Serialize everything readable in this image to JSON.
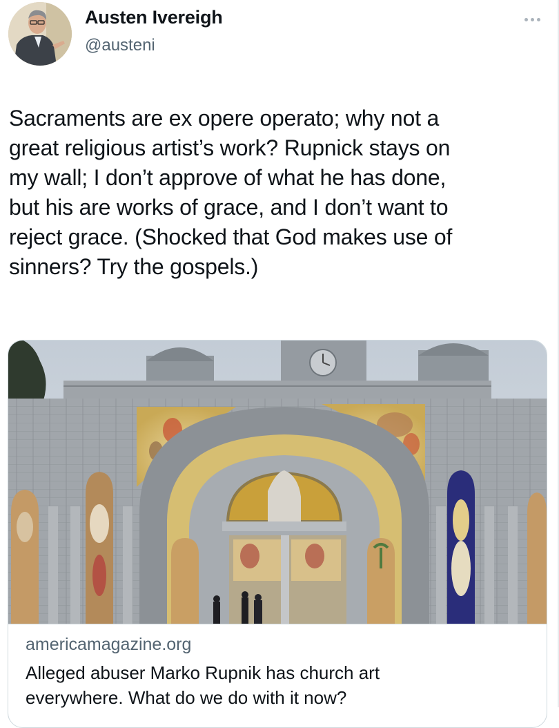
{
  "author": {
    "display_name": "Austen Ivereigh",
    "handle": "@austeni"
  },
  "icons": {
    "more": "more-options-icon"
  },
  "tweet": {
    "lines": [
      "Sacraments are ex opere operato; why not a",
      "great religious artist’s work? Rupnick stays on",
      "my wall; I don’t approve of what he has done,",
      "but his are works of grace, and I don’t want to",
      "reject grace. (Shocked that God makes use of",
      "sinners? Try the gospels.)"
    ]
  },
  "link_card": {
    "domain": "americamagazine.org",
    "title_lines": [
      "Alleged abuser Marko Rupnik has church art",
      "everywhere. What do we do with it now?"
    ]
  },
  "colors": {
    "text_primary": "#0f1419",
    "text_secondary": "#536471",
    "border": "#cfd9de"
  }
}
